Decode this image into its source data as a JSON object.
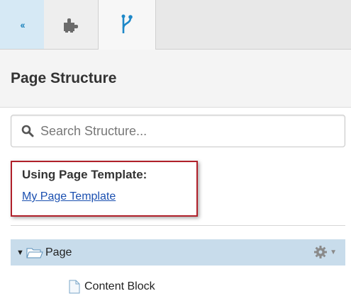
{
  "tabs": [
    {
      "name": "collapse",
      "icon": "double-chevron-left-icon",
      "glyph": "‹‹",
      "active": false
    },
    {
      "name": "components",
      "icon": "puzzle-icon",
      "active": false
    },
    {
      "name": "structure",
      "icon": "branch-icon",
      "active": true
    }
  ],
  "header": {
    "title": "Page Structure"
  },
  "search": {
    "placeholder": "Search Structure...",
    "value": ""
  },
  "template": {
    "heading": "Using Page Template:",
    "link_label": "My Page Template"
  },
  "tree": {
    "root": {
      "label": "Page",
      "expanded": true,
      "icon": "folder-icon",
      "action_icon": "gear-icon"
    },
    "children": [
      {
        "label": "Content Block",
        "icon": "document-icon"
      }
    ]
  },
  "colors": {
    "accent": "#2a8ac0",
    "highlight_border": "#b0202a",
    "link": "#1a4fb0",
    "selected_row": "#c8dceb"
  }
}
